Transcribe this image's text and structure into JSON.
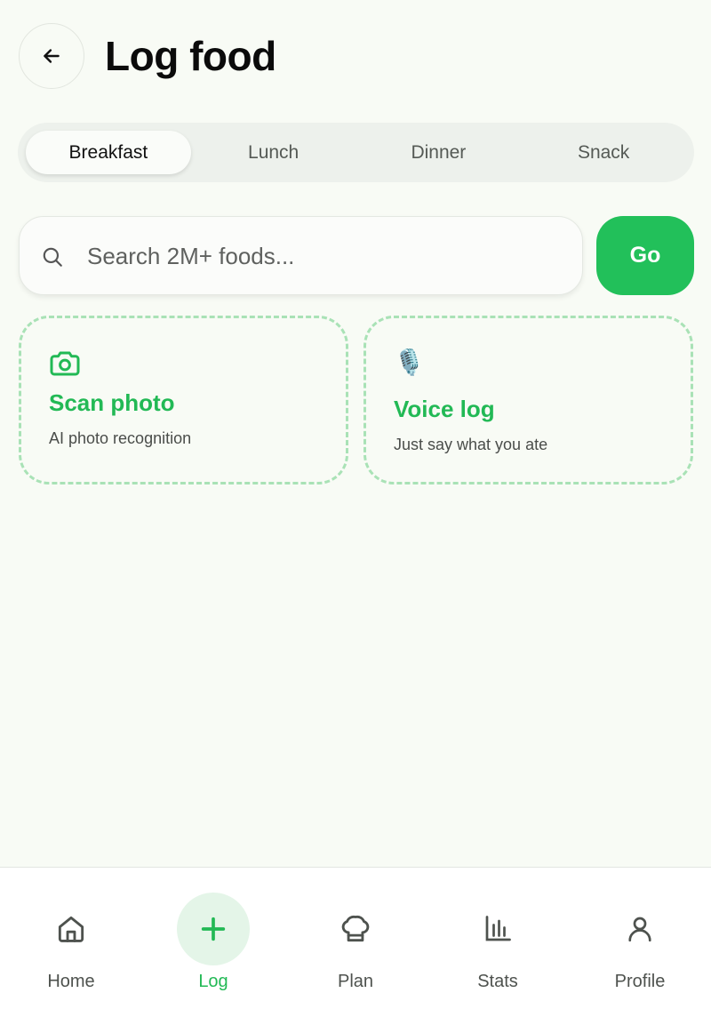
{
  "header": {
    "title": "Log food",
    "back_icon": "arrow-left-icon"
  },
  "meal_tabs": [
    {
      "label": "Breakfast",
      "selected": true
    },
    {
      "label": "Lunch",
      "selected": false
    },
    {
      "label": "Dinner",
      "selected": false
    },
    {
      "label": "Snack",
      "selected": false
    }
  ],
  "search": {
    "placeholder": "Search 2M+ foods...",
    "value": "",
    "icon": "search-icon",
    "go_label": "Go"
  },
  "actions": {
    "scan": {
      "icon": "camera-icon",
      "title": "Scan photo",
      "subtitle": "AI photo recognition"
    },
    "voice": {
      "icon": "microphone-icon",
      "emoji": "🎙️",
      "title": "Voice log",
      "subtitle": "Just say what you ate"
    }
  },
  "bottom_nav": [
    {
      "label": "Home",
      "icon": "home-icon",
      "active": false
    },
    {
      "label": "Log",
      "icon": "plus-icon",
      "active": true
    },
    {
      "label": "Plan",
      "icon": "chef-hat-icon",
      "active": false
    },
    {
      "label": "Stats",
      "icon": "bar-chart-icon",
      "active": false
    },
    {
      "label": "Profile",
      "icon": "user-icon",
      "active": false
    }
  ],
  "colors": {
    "accent": "#22c05a",
    "accent_text": "#22b955",
    "background": "#f8fbf5",
    "card_border": "#a9e2b6",
    "nav_active_bg": "#e4f5e8"
  }
}
